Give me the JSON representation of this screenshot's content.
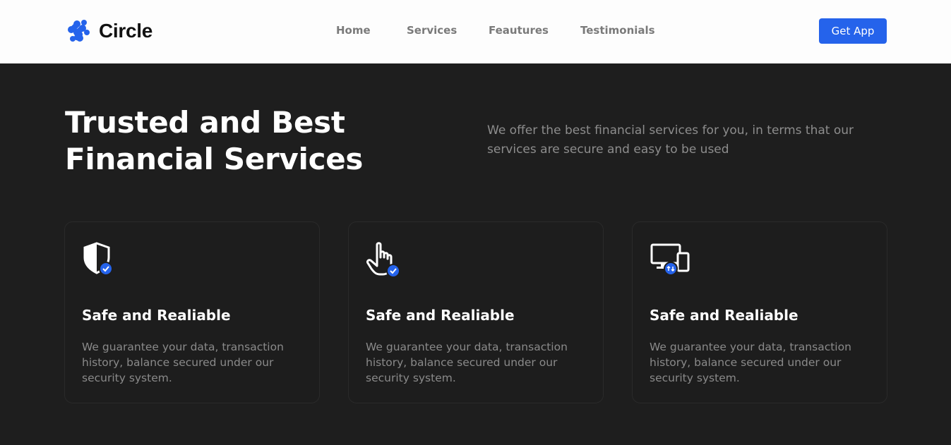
{
  "brand": {
    "name": "Circle",
    "accent": "#2563eb"
  },
  "nav": {
    "items": [
      "Home",
      "Services",
      "Feautures",
      "Testimonials"
    ]
  },
  "header": {
    "cta": "Get App"
  },
  "hero": {
    "title_line1": "Trusted and Best",
    "title_line2": "Financial Services",
    "description": "We offer the best financial services for you, in terms that our services are secure and easy to be used"
  },
  "cards": [
    {
      "icon": "shield-check-icon",
      "title": "Safe and Realiable",
      "text": "We guarantee your data, transaction history, balance secured under our security system."
    },
    {
      "icon": "pointer-hand-check-icon",
      "title": "Safe and Realiable",
      "text": "We guarantee your data, transaction history, balance secured under our security system."
    },
    {
      "icon": "devices-sync-icon",
      "title": "Safe and Realiable",
      "text": "We guarantee your data, transaction history, balance secured under our security system."
    }
  ]
}
